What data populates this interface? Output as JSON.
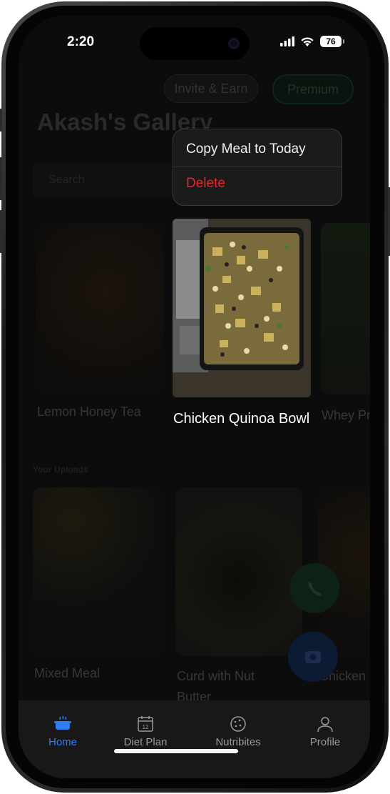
{
  "status_bar": {
    "time": "2:20",
    "battery": "76"
  },
  "header": {
    "invite_label": "Invite & Earn",
    "premium_label": "Premium",
    "title": "Akash's Gallery"
  },
  "search": {
    "placeholder": "Search"
  },
  "meals_row1": [
    {
      "name": "Lemon Honey Tea"
    },
    {
      "name": "Chicken Quinoa Bowl"
    },
    {
      "name": "Whey Protein Shake"
    }
  ],
  "section2": {
    "label": "Your Uploads"
  },
  "meals_row2": [
    {
      "name": "Mixed Meal"
    },
    {
      "name": "Curd with Nut Butter"
    },
    {
      "name": "Chicken Plate"
    }
  ],
  "context_menu": {
    "copy_label": "Copy Meal to Today",
    "delete_label": "Delete"
  },
  "bottom_nav": [
    {
      "label": "Home",
      "icon": "pot-icon",
      "active": true
    },
    {
      "label": "Diet Plan",
      "icon": "calendar-icon",
      "active": false,
      "calendar_day": "12"
    },
    {
      "label": "Nutribites",
      "icon": "cookie-icon",
      "active": false
    },
    {
      "label": "Profile",
      "icon": "person-icon",
      "active": false
    }
  ],
  "colors": {
    "accent": "#2f7bf5",
    "delete": "#e4262e",
    "premium": "#1f3529"
  }
}
